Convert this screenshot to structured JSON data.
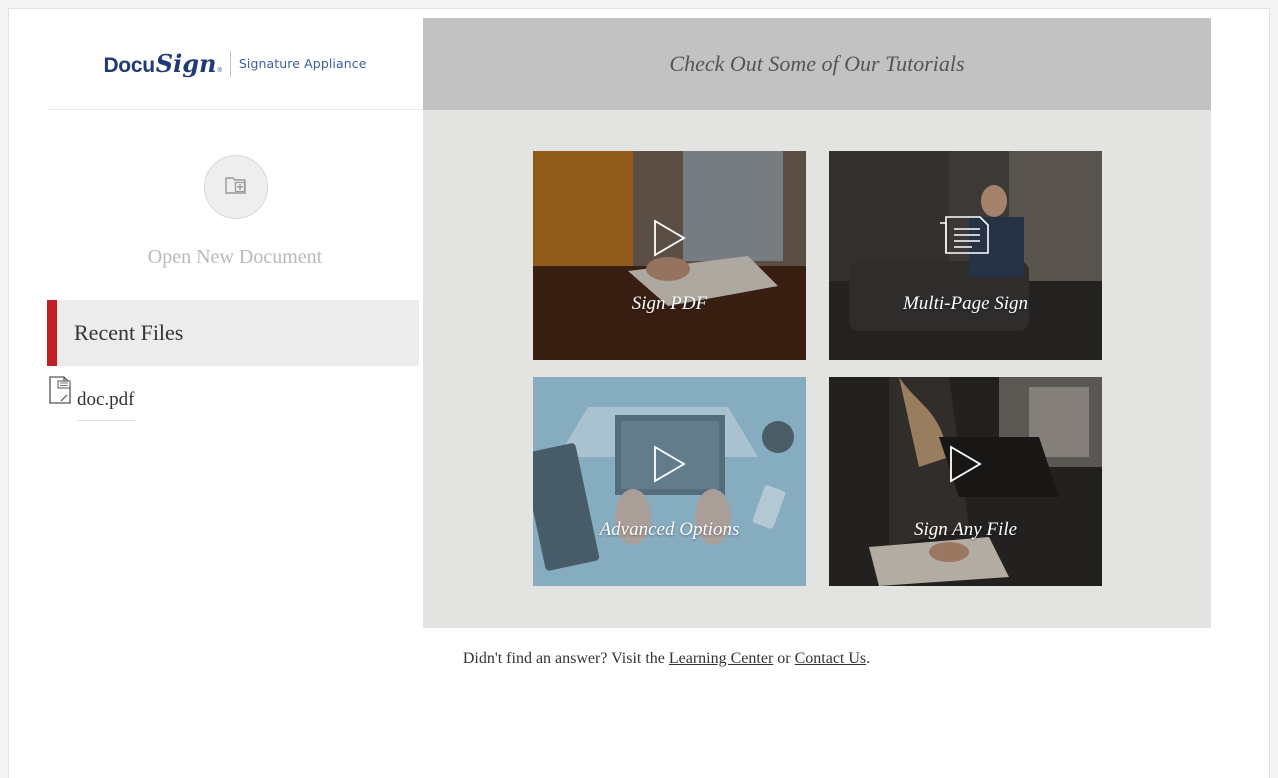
{
  "logo": {
    "docu": "Docu",
    "sign": "Sign",
    "reg": "®",
    "subtitle": "Signature Appliance"
  },
  "sidebar": {
    "open_label": "Open New Document",
    "open_icon": "folder-plus-icon",
    "recent_title": "Recent Files",
    "recent_files": [
      {
        "name": "doc.pdf",
        "icon": "pdf-file-icon"
      }
    ],
    "accent_color": "#c22026"
  },
  "tutorials": {
    "title": "Check Out Some of Our Tutorials",
    "tiles": [
      {
        "label": "Sign PDF",
        "icon": "play-icon"
      },
      {
        "label": "Multi-Page Sign",
        "icon": "document-icon"
      },
      {
        "label": "Advanced Options",
        "icon": "play-icon"
      },
      {
        "label": "Sign Any File",
        "icon": "play-icon"
      }
    ]
  },
  "footer": {
    "prefix": "Didn't find an answer? Visit the",
    "link1": "Learning Center",
    "middle": "or",
    "link2": "Contact Us",
    "suffix": "."
  },
  "colors": {
    "brand_navy": "#203a73",
    "brand_blue": "#3b5ea0",
    "header_gray": "#c2c2c2",
    "panel_gray": "#e3e3e2"
  }
}
